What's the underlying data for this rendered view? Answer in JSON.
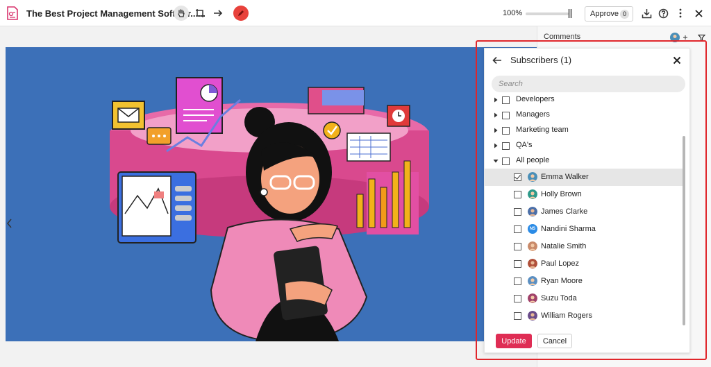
{
  "toolbar": {
    "document_title": "The Best Project Management Softwar......",
    "zoom": "100%",
    "approve_label": "Approve",
    "approve_count": "0",
    "icons": [
      "document-icon",
      "hand-icon",
      "crop-icon",
      "arrow-right-icon",
      "pen-icon",
      "download-icon",
      "help-icon",
      "more-vertical-icon",
      "close-icon"
    ],
    "accent_color": "#e8413b"
  },
  "comments": {
    "title": "Comments"
  },
  "subscribers_panel": {
    "title": "Subscribers (1)",
    "search_placeholder": "Search",
    "groups": [
      {
        "label": "Developers",
        "expanded": false,
        "checked": false
      },
      {
        "label": "Managers",
        "expanded": false,
        "checked": false
      },
      {
        "label": "Marketing team",
        "expanded": false,
        "checked": false
      },
      {
        "label": "QA's",
        "expanded": false,
        "checked": false
      },
      {
        "label": "All people",
        "expanded": true,
        "checked": false
      }
    ],
    "people": [
      {
        "name": "Emma Walker",
        "checked": true,
        "avatar_color": "#4a8fb8"
      },
      {
        "name": "Holly Brown",
        "checked": false,
        "avatar_color": "#2e9a8a"
      },
      {
        "name": "James Clarke",
        "checked": false,
        "avatar_color": "#4b6fa8"
      },
      {
        "name": "Nandini Sharma",
        "checked": false,
        "avatar_color": "#2b8be6",
        "initials": "NS"
      },
      {
        "name": "Natalie Smith",
        "checked": false,
        "avatar_color": "#c98a6a"
      },
      {
        "name": "Paul Lopez",
        "checked": false,
        "avatar_color": "#b0503a"
      },
      {
        "name": "Ryan Moore",
        "checked": false,
        "avatar_color": "#5a8fc2"
      },
      {
        "name": "Suzu Toda",
        "checked": false,
        "avatar_color": "#a0426a"
      },
      {
        "name": "William Rogers",
        "checked": false,
        "avatar_color": "#6a4c8a"
      }
    ],
    "update_label": "Update",
    "cancel_label": "Cancel",
    "update_color": "#df2d54"
  }
}
